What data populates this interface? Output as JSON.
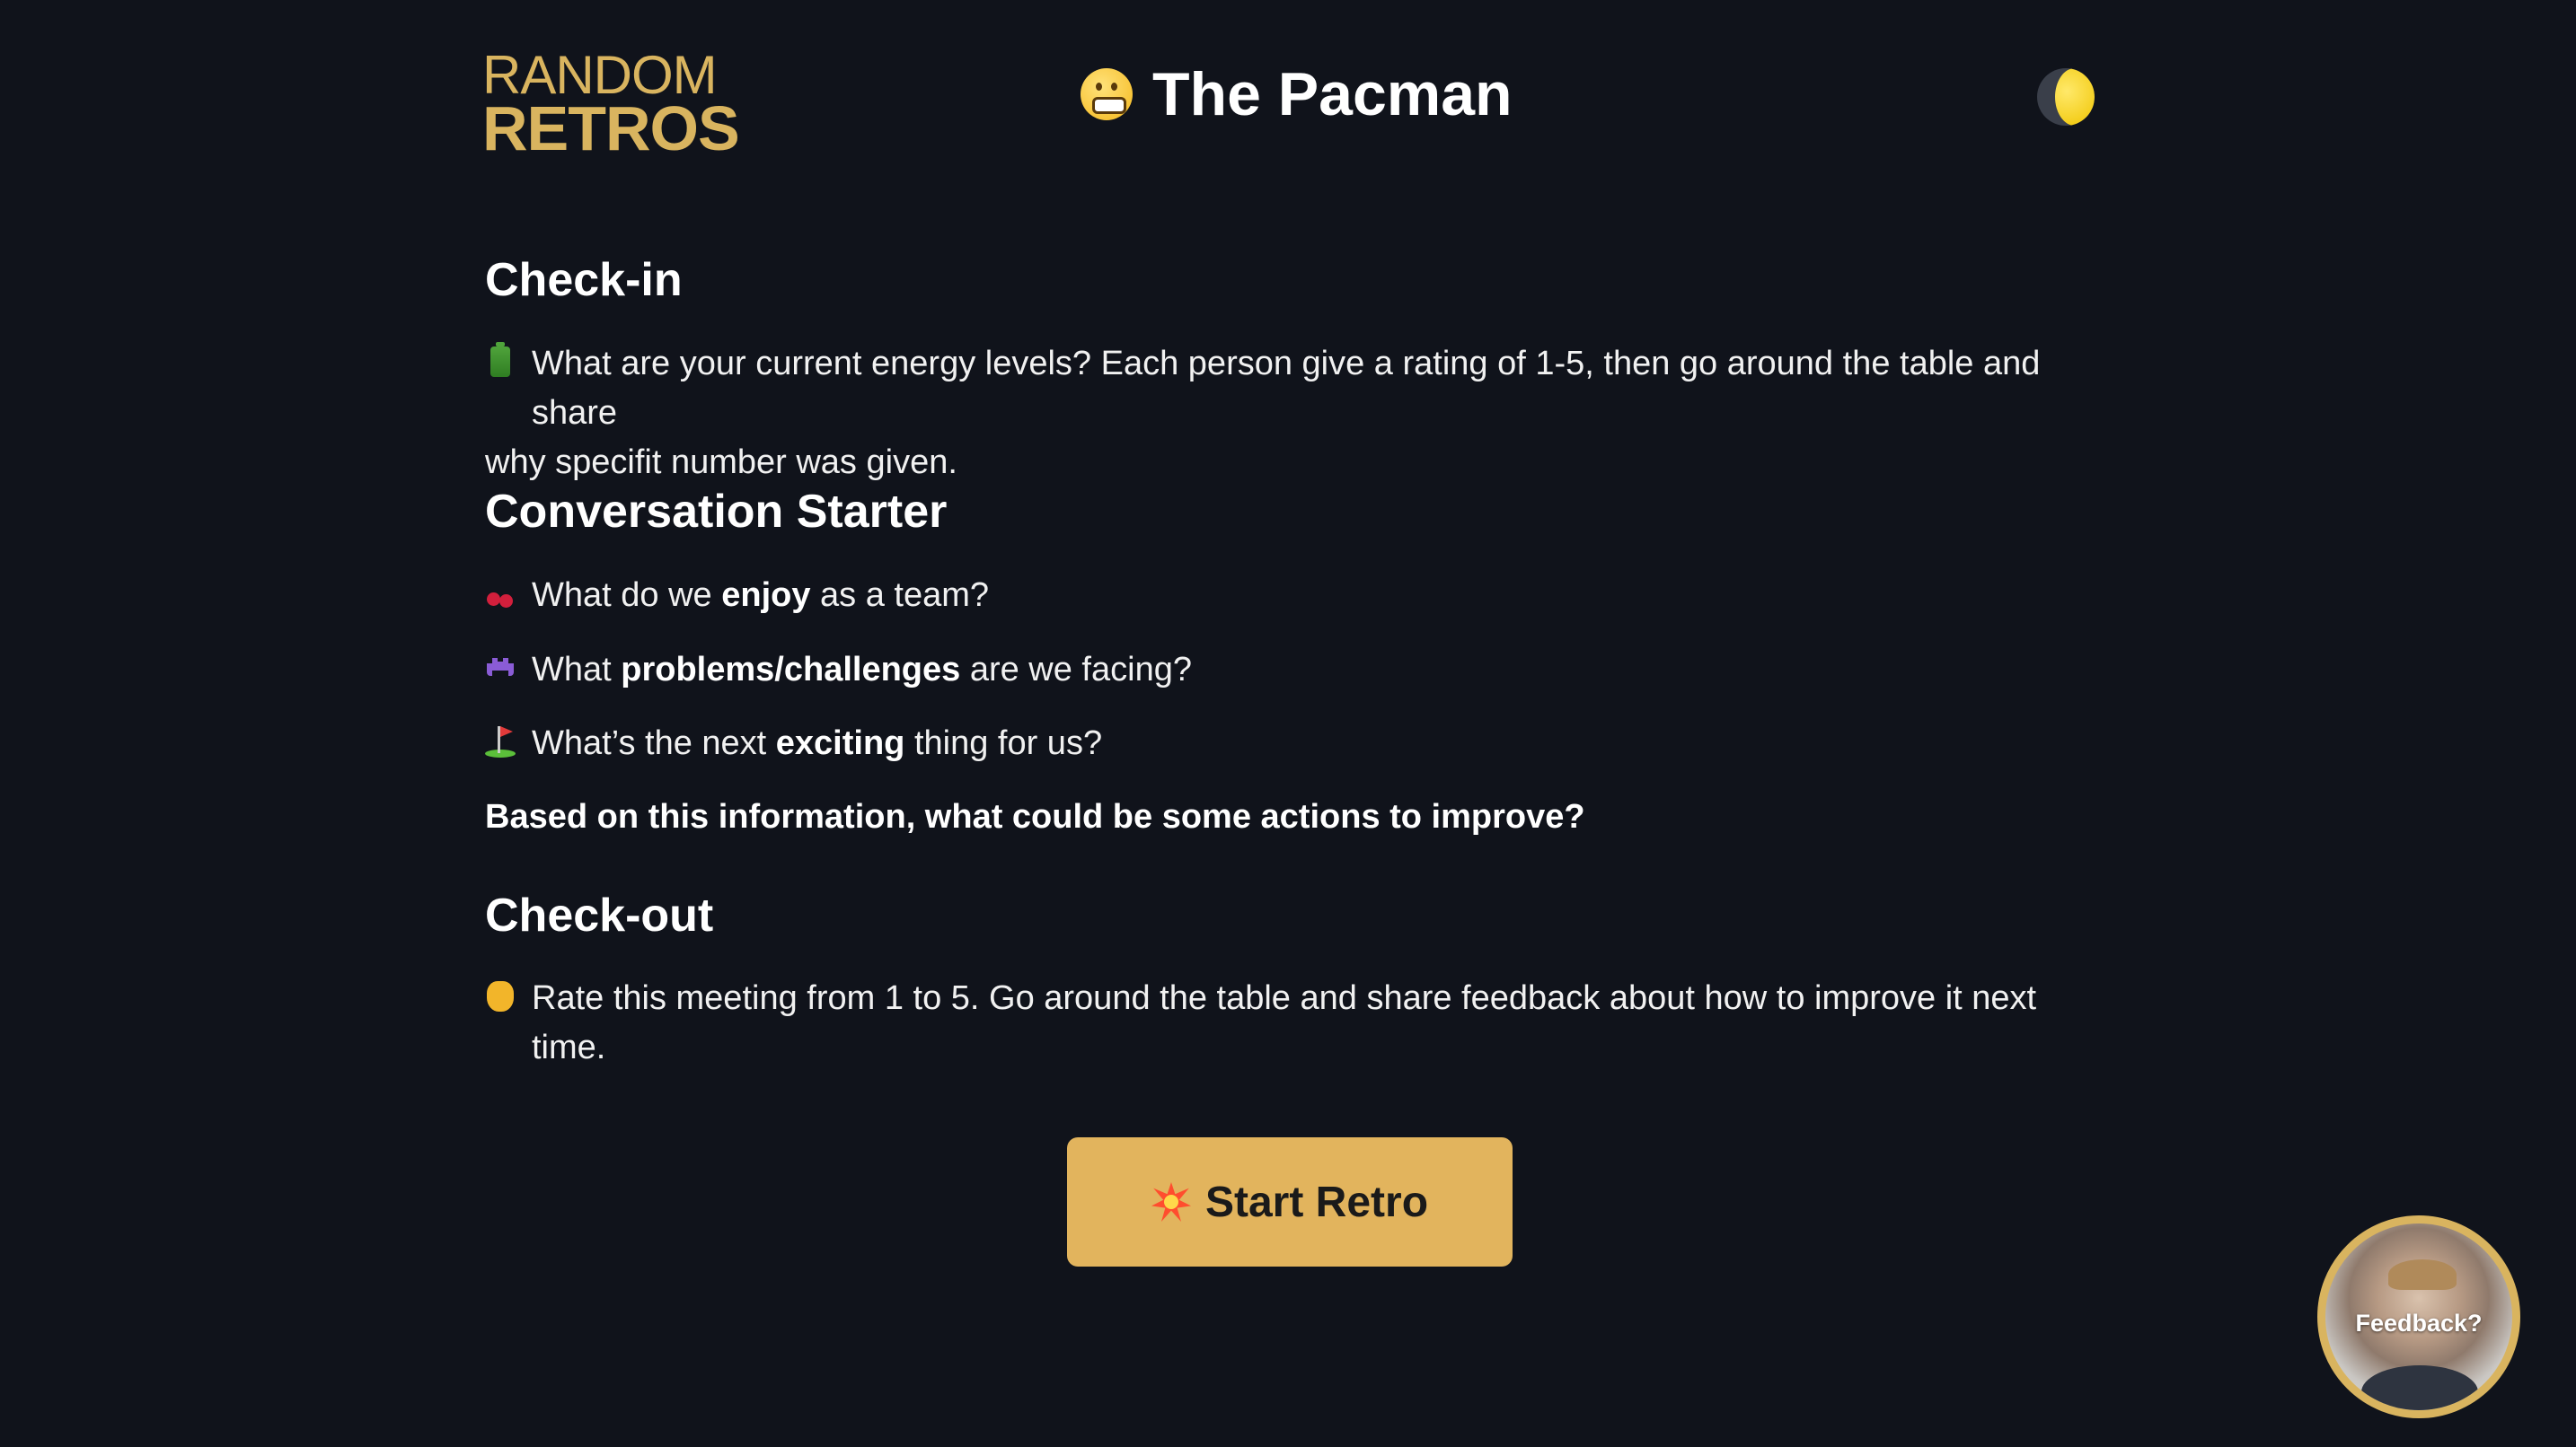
{
  "logo": {
    "line1": "RANDOM",
    "line2": "RETROS"
  },
  "title": {
    "emoji": "grimacing-face-icon",
    "text": "The Pacman"
  },
  "theme_toggle": {
    "icon": "moon-icon"
  },
  "sections": {
    "checkin": {
      "heading": "Check-in",
      "line1": "What are your current energy levels? Each person give a rating of 1-5, then go around the table and share",
      "line2": "why specifit number was given."
    },
    "conversation": {
      "heading": "Conversation Starter",
      "q1": {
        "pre": "What do we ",
        "bold": "enjoy",
        "post": " as a team?"
      },
      "q2": {
        "pre": "What ",
        "bold": "problems/challenges",
        "post": " are we facing?"
      },
      "q3": {
        "pre": "What’s the next ",
        "bold": "exciting",
        "post": " thing for us?"
      },
      "summary": "Based on this information, what could be some actions to improve?"
    },
    "checkout": {
      "heading": "Check-out",
      "text": "Rate this meeting from 1 to 5. Go around the table and share feedback about how to improve it next time."
    }
  },
  "start_button": {
    "label": "Start Retro"
  },
  "feedback": {
    "label": "Feedback?"
  },
  "colors": {
    "background": "#10131b",
    "accent": "#e2b45d",
    "logo": "#d9b45f"
  }
}
